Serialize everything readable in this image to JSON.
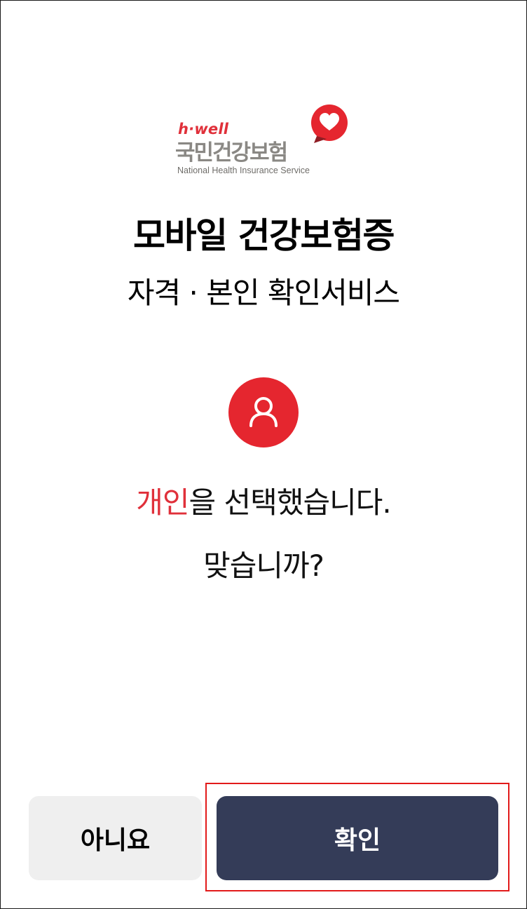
{
  "logo": {
    "brand": "h·well",
    "name_kr": "국민건강보험",
    "name_en": "National Health Insurance Service"
  },
  "title": "모바일 건강보험증",
  "subtitle": "자격 · 본인 확인서비스",
  "avatar_icon": "person-icon",
  "message": {
    "highlight": "개인",
    "rest": "을 선택했습니다."
  },
  "question": "맞습니까?",
  "buttons": {
    "no_label": "아니요",
    "ok_label": "확인"
  },
  "colors": {
    "accent_red": "#e5262f",
    "primary_button": "#343c58",
    "secondary_button": "#efefef"
  }
}
